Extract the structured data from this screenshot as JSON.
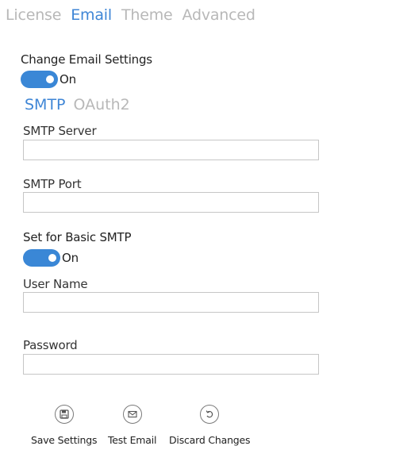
{
  "top_tabs": [
    {
      "label": "License",
      "active": false
    },
    {
      "label": "Email",
      "active": true
    },
    {
      "label": "Theme",
      "active": false
    },
    {
      "label": "Advanced",
      "active": false
    }
  ],
  "change_email": {
    "label": "Change Email Settings",
    "toggle_state": "On"
  },
  "sub_tabs": [
    {
      "label": "SMTP",
      "active": true
    },
    {
      "label": "OAuth2",
      "active": false
    }
  ],
  "fields": {
    "smtp_server": {
      "label": "SMTP Server",
      "value": ""
    },
    "smtp_port": {
      "label": "SMTP Port",
      "value": ""
    },
    "user_name": {
      "label": "User Name",
      "value": ""
    },
    "password": {
      "label": "Password",
      "value": ""
    }
  },
  "basic_smtp": {
    "label": "Set for Basic SMTP",
    "toggle_state": "On"
  },
  "actions": {
    "save_label": "Save Settings",
    "test_label": "Test Email",
    "discard_label": "Discard Changes"
  },
  "colors": {
    "accent": "#3f86d6",
    "toggle_on": "#3a87d6",
    "inactive_tab": "#b8b8b8"
  },
  "icons": {
    "save": "floppy-disk-icon",
    "test": "envelope-icon",
    "discard": "undo-icon"
  }
}
